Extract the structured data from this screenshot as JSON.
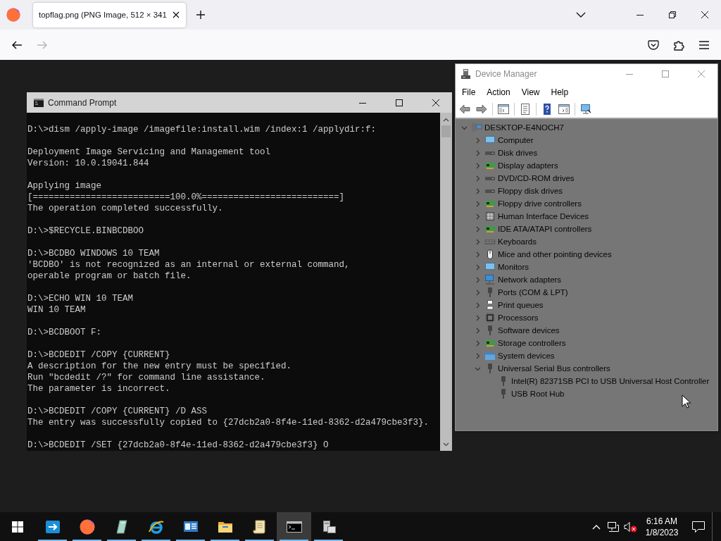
{
  "browser": {
    "tabs": [
      {
        "title": "topflag.png (PNG Image, 512 × 341",
        "selected": true
      }
    ],
    "nav_buttons": [
      {
        "kind": "back",
        "disabled": false
      },
      {
        "kind": "forward",
        "disabled": true
      }
    ]
  },
  "command_prompt": {
    "title": "Command Prompt",
    "output": [
      [
        "D:\\>dism /apply-image /imagefile:install.wim /index:1 /applydir:f:"
      ],
      [
        "Deployment Image Servicing and Management tool",
        "Version: 10.0.19041.844"
      ],
      [
        "Applying image",
        "[==========================100.0%==========================]",
        "The operation completed successfully."
      ],
      [
        "D:\\>$RECYCLE.BINBCDBOO"
      ],
      [
        "D:\\>BCDBO WINDOWS 10 TEAM",
        "'BCDBO' is not recognized as an internal or external command,",
        "operable program or batch file."
      ],
      [
        "D:\\>ECHO WIN 10 TEAM",
        "WIN 10 TEAM"
      ],
      [
        "D:\\>BCDBOOT F:"
      ],
      [
        "D:\\>BCDEDIT /COPY {CURRENT}",
        "A description for the new entry must be specified.",
        "Run \"bcdedit /?\" for command line assistance.",
        "The parameter is incorrect."
      ],
      [
        "D:\\>BCDEDIT /COPY {CURRENT} /D ASS",
        "The entry was successfully copied to {27dcb2a0-8f4e-11ed-8362-d2a479cbe3f3}."
      ],
      [
        "D:\\>BCDEDIT /SET {27dcb2a0-8f4e-11ed-8362-d2a479cbe3f3} O"
      ]
    ]
  },
  "device_manager": {
    "title": "Device Manager",
    "menu": [
      "File",
      "Action",
      "View",
      "Help"
    ],
    "tree": [
      {
        "label": "DESKTOP-E4NOCH7",
        "kind": "pc",
        "expanded": true,
        "children": [
          {
            "label": "Computer",
            "kind": "computer",
            "expanded": false
          },
          {
            "label": "Disk drives",
            "kind": "drive",
            "expanded": false
          },
          {
            "label": "Display adapters",
            "kind": "card",
            "expanded": false
          },
          {
            "label": "DVD/CD-ROM drives",
            "kind": "drive",
            "expanded": false
          },
          {
            "label": "Floppy disk drives",
            "kind": "drive",
            "expanded": false
          },
          {
            "label": "Floppy drive controllers",
            "kind": "card",
            "expanded": false
          },
          {
            "label": "Human Interface Devices",
            "kind": "keypad",
            "expanded": false
          },
          {
            "label": "IDE ATA/ATAPI controllers",
            "kind": "card",
            "expanded": false
          },
          {
            "label": "Keyboards",
            "kind": "keyboard",
            "expanded": false
          },
          {
            "label": "Mice and other pointing devices",
            "kind": "mouse",
            "expanded": false
          },
          {
            "label": "Monitors",
            "kind": "computer",
            "expanded": false
          },
          {
            "label": "Network adapters",
            "kind": "network",
            "expanded": false
          },
          {
            "label": "Ports (COM & LPT)",
            "kind": "plug",
            "expanded": false
          },
          {
            "label": "Print queues",
            "kind": "printer",
            "expanded": false
          },
          {
            "label": "Processors",
            "kind": "chip",
            "expanded": false
          },
          {
            "label": "Software devices",
            "kind": "plug",
            "expanded": false
          },
          {
            "label": "Storage controllers",
            "kind": "card",
            "expanded": false
          },
          {
            "label": "System devices",
            "kind": "system",
            "expanded": false
          },
          {
            "label": "Universal Serial Bus controllers",
            "kind": "plug",
            "expanded": true,
            "children": [
              {
                "label": "Intel(R) 82371SB PCI to USB Universal Host Controller",
                "kind": "plug"
              },
              {
                "label": "USB Root Hub",
                "kind": "plug"
              }
            ]
          }
        ]
      }
    ]
  },
  "taskbar": {
    "apps": [
      {
        "kind": "transfer",
        "running": true,
        "selected": false
      },
      {
        "kind": "browser",
        "running": true,
        "selected": false
      },
      {
        "kind": "slate",
        "running": true,
        "selected": false
      },
      {
        "kind": "web",
        "running": true,
        "selected": false
      },
      {
        "kind": "panel",
        "running": true,
        "selected": false
      },
      {
        "kind": "folder",
        "running": true,
        "selected": false
      },
      {
        "kind": "scroll",
        "running": true,
        "selected": false
      },
      {
        "kind": "console",
        "running": true,
        "selected": true
      },
      {
        "kind": "devices",
        "running": true,
        "selected": false
      }
    ],
    "volume_muted": true,
    "clock": {
      "time": "6:16 AM",
      "date": "1/8/2023"
    }
  }
}
